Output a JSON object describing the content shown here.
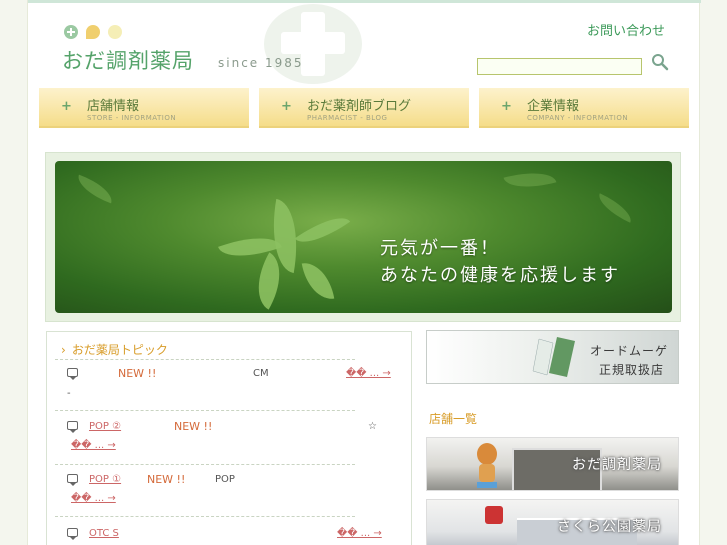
{
  "header": {
    "logo_text": "おだ調剤薬局",
    "since": "since 1985",
    "contact_label": "お問い合わせ",
    "search_placeholder": ""
  },
  "nav": [
    {
      "label": "店舗情報",
      "sub": "STORE - INFORMATION"
    },
    {
      "label": "おだ薬剤師ブログ",
      "sub": "PHARMACIST - BLOG"
    },
    {
      "label": "企業情報",
      "sub": "COMPANY - INFORMATION"
    }
  ],
  "hero": {
    "line1": "元気が一番！",
    "line2": "あなたの健康を応援します"
  },
  "topics": {
    "heading": "おだ薬局トピック",
    "items": [
      {
        "new": "NEW !!",
        "mid": "CM",
        "tail": "�� ... →",
        "extra": "-"
      },
      {
        "title": "POP ②",
        "new": "NEW !!",
        "star": "☆",
        "tail": "�� ... →"
      },
      {
        "title": "POP ①",
        "new": "NEW !!",
        "mid": "POP",
        "tail": "�� ... →"
      },
      {
        "title": "OTC S",
        "tail": "�� ... →"
      }
    ]
  },
  "ad": {
    "line1": "オードムーゲ",
    "line2": "正規取扱店"
  },
  "stores": {
    "heading": "店舗一覧",
    "items": [
      {
        "name": "おだ調剤薬局"
      },
      {
        "name": "さくら公園薬局"
      }
    ]
  },
  "colors": {
    "brand_green": "#55a36a",
    "accent_orange": "#d89c28",
    "nav_yellow": "#f5dd8a"
  }
}
